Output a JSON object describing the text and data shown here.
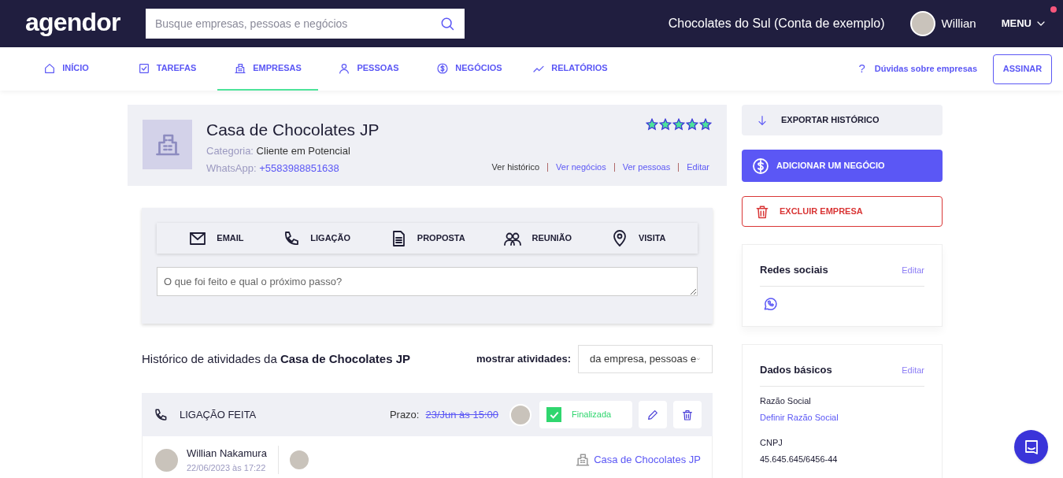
{
  "header": {
    "logo": "agendor",
    "search": {
      "placeholder": "Busque empresas, pessoas e negócios"
    },
    "account": "Chocolates do Sul (Conta de exemplo)",
    "user": "Willian",
    "menu": "MENU",
    "notification": true
  },
  "nav": {
    "tabs": [
      {
        "label": "INÍCIO",
        "kind": "home",
        "selected": false
      },
      {
        "label": "TAREFAS",
        "kind": "task",
        "selected": false
      },
      {
        "label": "EMPRESAS",
        "kind": "building",
        "selected": true
      },
      {
        "label": "PESSOAS",
        "kind": "person",
        "selected": false
      },
      {
        "label": "NEGÓCIOS",
        "kind": "money",
        "selected": false
      },
      {
        "label": "RELATÓRIOS",
        "kind": "chart",
        "selected": false
      }
    ],
    "help": "?",
    "help_link": "Dúvidas sobre empresas",
    "subscribe": "ASSINAR"
  },
  "company": {
    "name": "Casa de Chocolates JP",
    "category_label": "Categoria:",
    "category": "Cliente em Potencial",
    "whatsapp_label": "WhatsApp:",
    "whatsapp": "+5583988851638",
    "stars": 5,
    "links": [
      {
        "label": "Ver histórico",
        "selected": true
      },
      {
        "label": "Ver negócios",
        "selected": false
      },
      {
        "label": "Ver pessoas",
        "selected": false
      },
      {
        "label": "Editar",
        "selected": false
      }
    ]
  },
  "activity_form": {
    "types": [
      {
        "label": "EMAIL",
        "kind": "email"
      },
      {
        "label": "LIGAÇÃO",
        "kind": "phone"
      },
      {
        "label": "PROPOSTA",
        "kind": "document"
      },
      {
        "label": "REUNIÃO",
        "kind": "people"
      },
      {
        "label": "VISITA",
        "kind": "pin"
      }
    ],
    "placeholder": "O que foi feito e qual o próximo passo?"
  },
  "history": {
    "title": "Histórico de atividades da **Casa de Chocolates JP**",
    "filter_label": "mostrar atividades:",
    "filter_value": "da empresa, pessoas e",
    "items": [
      {
        "type": "LIGAÇÃO FEITA",
        "deadline_label": "Prazo:",
        "deadline": "23/Jun às 15:00",
        "done": true,
        "status": "Finalizada",
        "author": "Willian Nakamura",
        "date": "22/06/2023 às 17:22",
        "company": "Casa de Chocolates JP"
      }
    ]
  },
  "sidebar": {
    "export": "EXPORTAR HISTÓRICO",
    "add_deal": "ADICIONAR UM NEGÓCIO",
    "delete": "EXCLUIR EMPRESA",
    "social": {
      "title": "Redes sociais",
      "edit": "Editar"
    },
    "basic": {
      "title": "Dados básicos",
      "edit": "Editar",
      "fields": [
        {
          "label": "Razão Social",
          "value": "Definir Razão Social",
          "kind": "link"
        },
        {
          "label": "CNPJ",
          "value": "45.645.645/6456-44",
          "kind": "text"
        }
      ]
    }
  }
}
